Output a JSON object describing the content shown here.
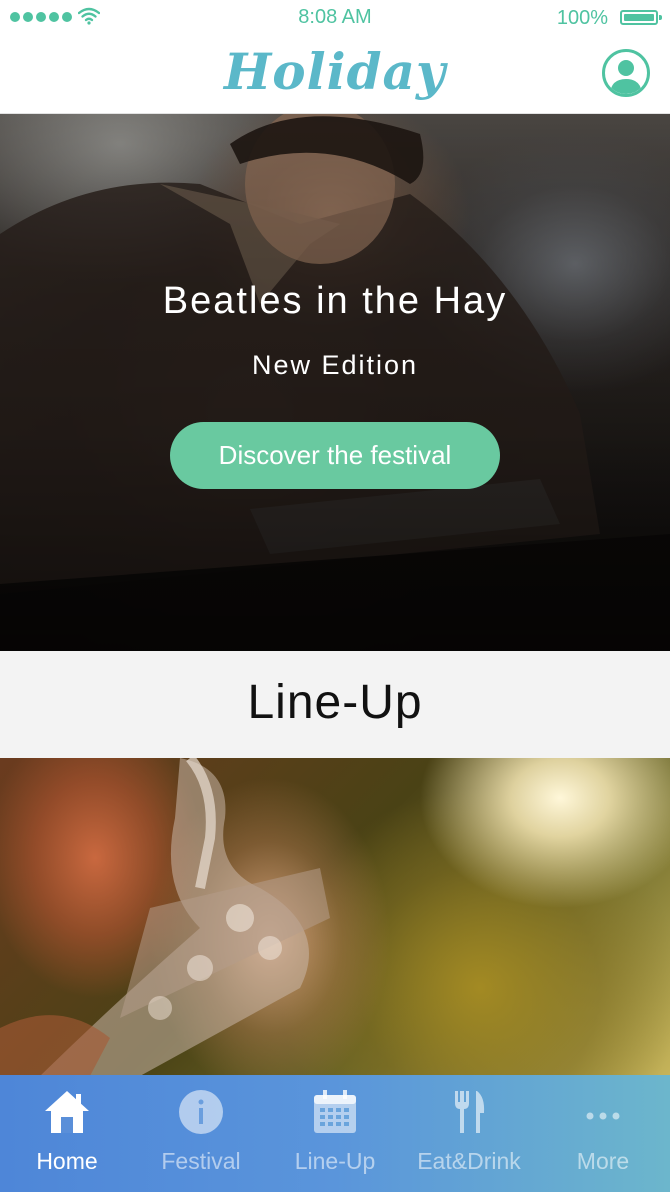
{
  "status_bar": {
    "time": "8:08 AM",
    "battery": "100%"
  },
  "header": {
    "logo": "Holiday"
  },
  "hero": {
    "title": "Beatles in the Hay",
    "subtitle": "New Edition",
    "cta_label": "Discover the festival"
  },
  "lineup": {
    "title": "Line-Up"
  },
  "tab_bar": {
    "tabs": [
      {
        "label": "Home",
        "icon": "home-icon",
        "active": true
      },
      {
        "label": "Festival",
        "icon": "info-icon",
        "active": false
      },
      {
        "label": "Line-Up",
        "icon": "calendar-icon",
        "active": false
      },
      {
        "label": "Eat&Drink",
        "icon": "fork-knife-icon",
        "active": false
      },
      {
        "label": "More",
        "icon": "more-icon",
        "active": false
      }
    ]
  },
  "colors": {
    "accent": "#4fc3a1",
    "logo": "#5bb8c9",
    "cta": "#69c9a0",
    "tab_bar_start": "#4e86d8",
    "tab_bar_end": "#6cb6cc"
  }
}
